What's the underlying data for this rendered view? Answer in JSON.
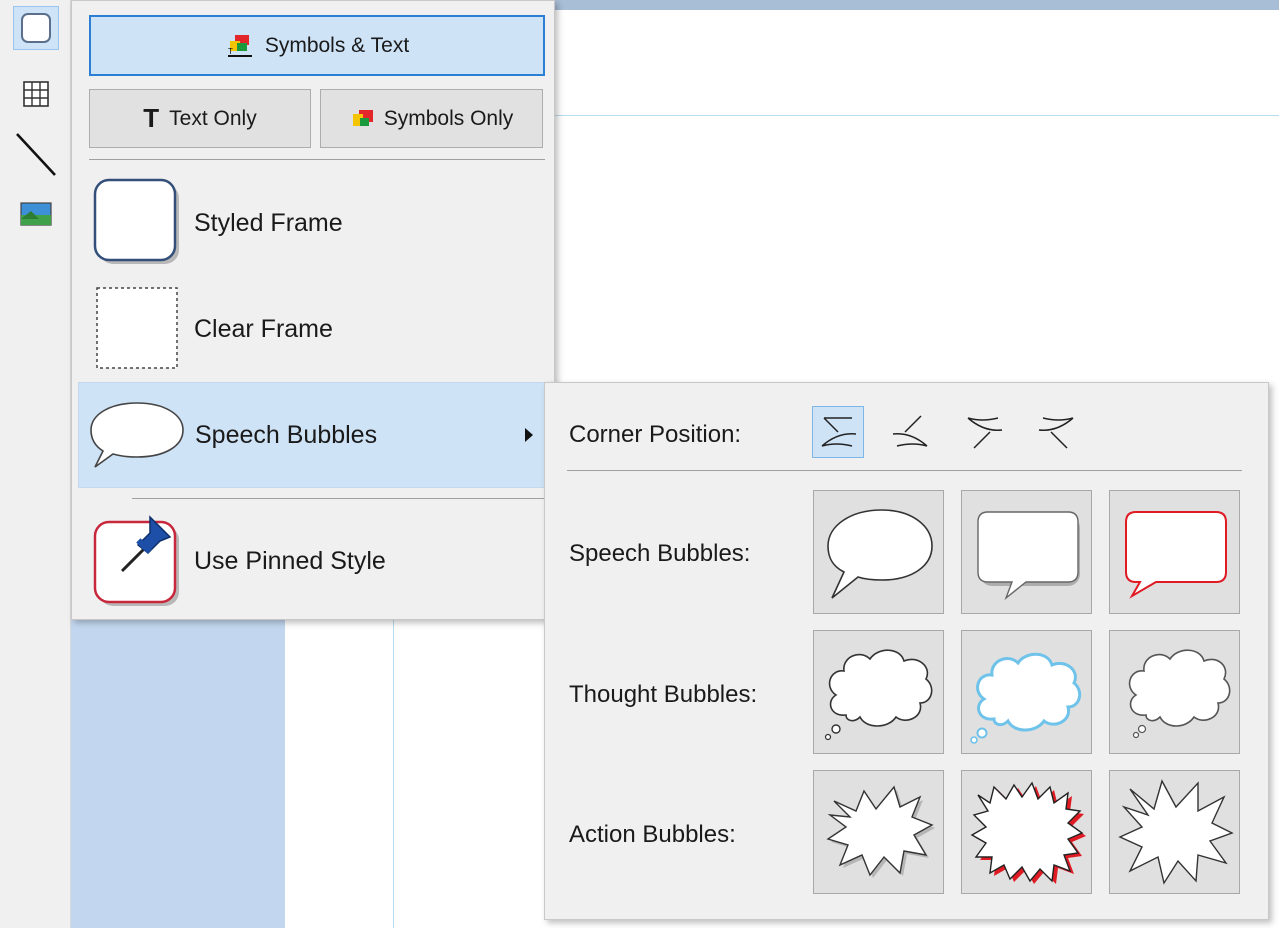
{
  "toolbar": {
    "tools": [
      {
        "name": "frame-tool",
        "icon": "rounded-rect-icon",
        "selected": true
      },
      {
        "name": "table-tool",
        "icon": "grid-icon",
        "selected": false
      },
      {
        "name": "line-tool",
        "icon": "line-icon",
        "selected": false
      },
      {
        "name": "image-tool",
        "icon": "landscape-image-icon",
        "selected": false
      }
    ]
  },
  "menu": {
    "symbols_text_label": "Symbols & Text",
    "text_only_label": "Text Only",
    "symbols_only_label": "Symbols Only",
    "styled_frame_label": "Styled Frame",
    "clear_frame_label": "Clear Frame",
    "speech_bubbles_label": "Speech Bubbles",
    "pinned_style_label": "Use Pinned Style"
  },
  "submenu": {
    "corner_label": "Corner Position:",
    "speech_label": "Speech Bubbles:",
    "thought_label": "Thought Bubbles:",
    "action_label": "Action Bubbles:",
    "selected_corner": 0
  },
  "colors": {
    "accent": "#2a7fd4",
    "selection_bg": "#cfe3f7",
    "pinned_red": "#c8283c",
    "pin_blue": "#1d4fa8",
    "bubble_cyan": "#6fc3ea",
    "action_red": "#e01b24"
  }
}
